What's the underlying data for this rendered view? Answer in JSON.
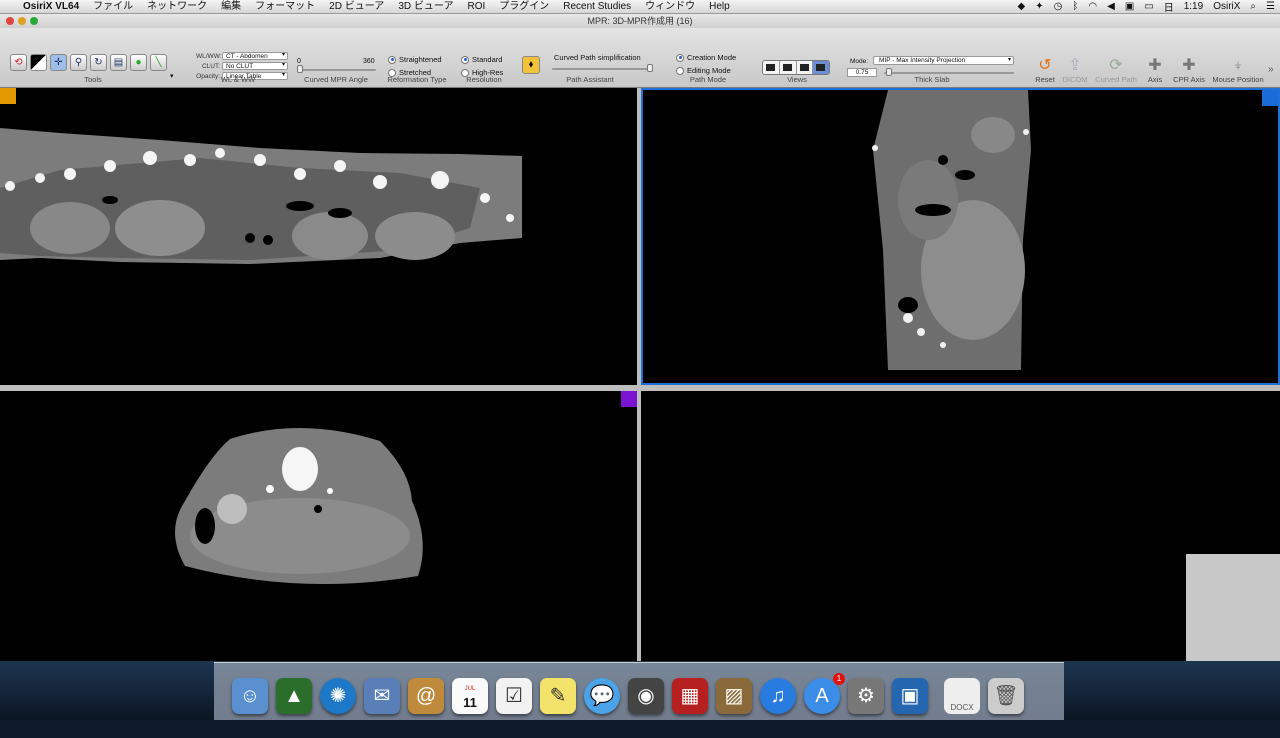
{
  "menubar": {
    "app": "OsiriX VL64",
    "items": [
      "ファイル",
      "ネットワーク",
      "編集",
      "フォーマット",
      "2D ビューア",
      "3D ビューア",
      "ROI",
      "プラグイン",
      "Recent Studies",
      "ウィンドウ",
      "Help"
    ],
    "day": "日",
    "time": "1:19",
    "user": "OsiriX"
  },
  "window": {
    "title": "MPR: 3D-MPR作成用 (16)"
  },
  "toolbar": {
    "labels": {
      "tools": "Tools",
      "wlww": "WL & WW",
      "angle": "Curved MPR Angle",
      "reformation": "Reformation Type",
      "resolution": "Resolution",
      "assistant": "Path Assistant",
      "pathmode": "Path Mode",
      "views": "Views",
      "thickslab": "Thick Slab",
      "reset": "Reset",
      "dicom": "DICOM",
      "curved": "Curved Path",
      "axis": "Axis",
      "cpraxis": "CPR Axis",
      "mouse": "Mouse Position"
    },
    "wl_label": "WL/WW:",
    "wl_value": "CT - Abdomen",
    "clut_label": "CLUT:",
    "clut_value": "No CLUT",
    "opacity_label": "Opacity:",
    "opacity_value": "Linear Table",
    "angle_min": "0",
    "angle_max": "360",
    "reformation": {
      "opt1": "Straightened",
      "opt2": "Stretched"
    },
    "resolution": {
      "opt1": "Standard",
      "opt2": "High-Res"
    },
    "simplification": "Curved Path simplification",
    "pathmode": {
      "opt1": "Creation Mode",
      "opt2": "Editing Mode"
    },
    "mode_label": "Mode:",
    "mode_value": "MIP - Max Intensity Projection",
    "slab_value": "0.75"
  },
  "dock": {
    "calendar_month": "JUL",
    "calendar_day": "11",
    "docx": "DOCX",
    "badge": "1"
  }
}
